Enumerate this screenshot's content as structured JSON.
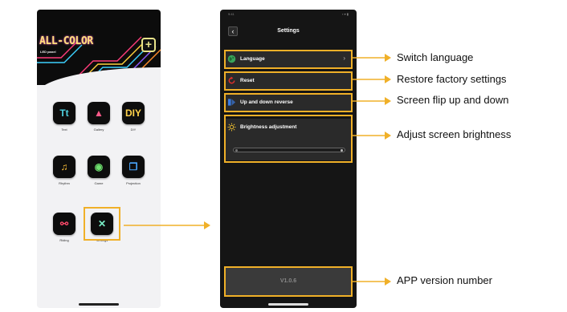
{
  "left_phone": {
    "brand_name": "ALL-COLOR",
    "brand_subtitle": "LED panel",
    "add_button": "+",
    "apps": [
      {
        "label": "Text",
        "glyph": "Tt",
        "icon": "text-icon",
        "color": "#4fd1e0"
      },
      {
        "label": "Gallery",
        "glyph": "▲",
        "icon": "gallery-icon",
        "color": "#ff5a8a"
      },
      {
        "label": "DIY",
        "glyph": "DIY",
        "icon": "diy-icon",
        "color": "#ffd24a"
      },
      {
        "label": "Rhythm",
        "glyph": "♫",
        "icon": "music-note-icon",
        "color": "#ffc23a"
      },
      {
        "label": "Game",
        "glyph": "◉",
        "icon": "game-robot-icon",
        "color": "#6ee06e"
      },
      {
        "label": "Projection",
        "glyph": "❐",
        "icon": "projection-icon",
        "color": "#4aa8ff"
      },
      {
        "label": "Riding",
        "glyph": "⚯",
        "icon": "bicycle-icon",
        "color": "#ff4a6a"
      },
      {
        "label": "Settings",
        "glyph": "✕",
        "icon": "wrench-screwdriver-icon",
        "color": "#7af0c8"
      }
    ]
  },
  "right_phone": {
    "title": "Settings",
    "status_time": "9:41",
    "status_icons": "▪ ▾ ▮",
    "back_icon": "chevron-left-icon",
    "rows": [
      {
        "label": "Language",
        "icon": "globe-icon",
        "icon_color": "#3aa55a",
        "has_chevron": true,
        "chevron": "›"
      },
      {
        "label": "Reset",
        "icon": "reset-icon",
        "icon_color": "#e0302a",
        "has_chevron": false
      },
      {
        "label": "Up and down reverse",
        "icon": "flip-icon",
        "icon_color": "#3a7be0",
        "has_chevron": false
      }
    ],
    "brightness": {
      "label": "Brightness adjustment",
      "icon": "sun-icon",
      "icon_color": "#f0c030",
      "level": 1.0
    },
    "version": "V1.0.6"
  },
  "annotations": [
    {
      "text": "Switch language"
    },
    {
      "text": "Restore factory settings"
    },
    {
      "text": "Screen flip up and down"
    },
    {
      "text": "Adjust screen brightness"
    },
    {
      "text": "APP version number"
    }
  ],
  "colors": {
    "highlight": "#f0b028",
    "dark_bg": "#151515",
    "row_bg": "#2a2a2a"
  }
}
